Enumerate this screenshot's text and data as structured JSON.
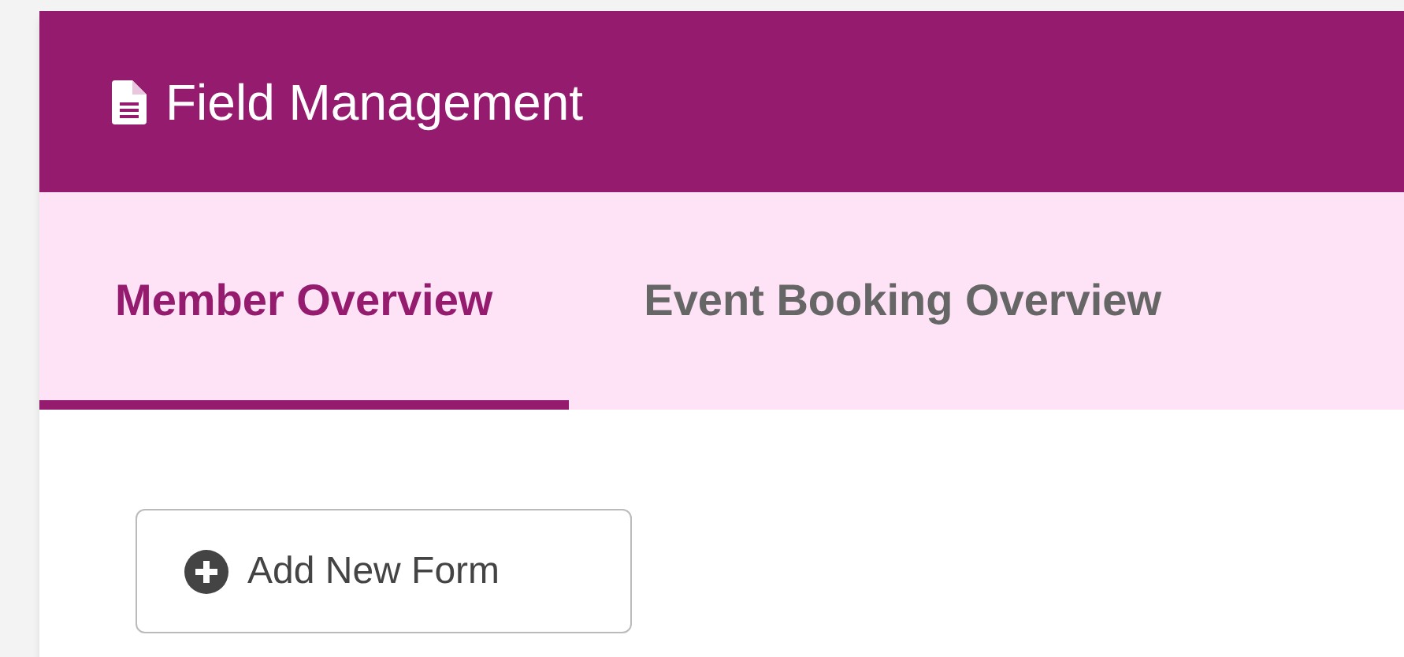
{
  "header": {
    "title": "Field Management"
  },
  "tabs": [
    {
      "label": "Member Overview",
      "selected": true
    },
    {
      "label": "Event Booking Overview",
      "selected": false
    }
  ],
  "actions": [
    {
      "label": "Add New Form"
    }
  ]
}
